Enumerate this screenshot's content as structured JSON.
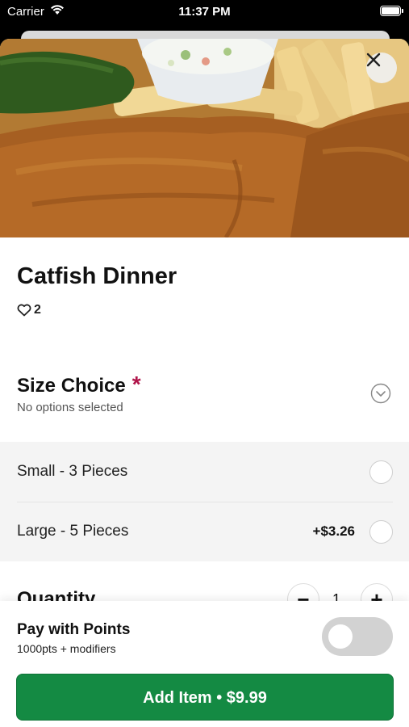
{
  "status_bar": {
    "carrier": "Carrier",
    "time": "11:37 PM"
  },
  "item": {
    "title": "Catfish Dinner",
    "likes": "2"
  },
  "size_choice": {
    "title": "Size Choice",
    "required_mark": "*",
    "subtitle": "No options selected",
    "options": [
      {
        "label": "Small - 3 Pieces",
        "price": ""
      },
      {
        "label": "Large - 5 Pieces",
        "price": "+$3.26"
      }
    ]
  },
  "quantity": {
    "label": "Quantity",
    "decrement": "−",
    "value": "1",
    "increment": "+"
  },
  "points": {
    "title": "Pay with Points",
    "subtitle": "1000pts + modifiers",
    "enabled": false
  },
  "add_button": {
    "label": "Add Item • $9.99"
  },
  "colors": {
    "accent_green": "#148a43",
    "required_red": "#b0154a"
  },
  "icons": [
    "wifi-icon",
    "battery-icon",
    "close-icon",
    "heart-icon",
    "chevron-down-icon"
  ]
}
